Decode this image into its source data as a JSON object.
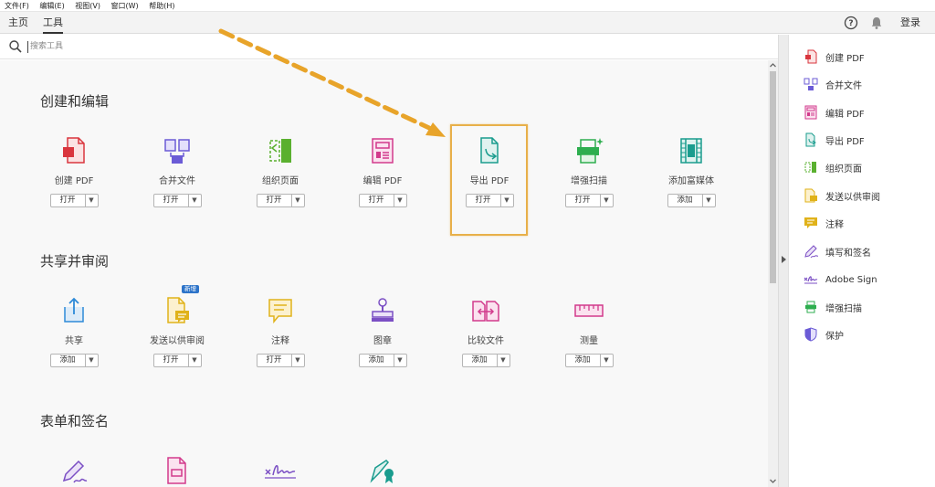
{
  "menubar": {
    "items": [
      "文件(F)",
      "编辑(E)",
      "视图(V)",
      "窗口(W)",
      "帮助(H)"
    ]
  },
  "tabs": {
    "home": "主页",
    "tools": "工具",
    "login": "登录"
  },
  "search": {
    "placeholder": "搜索工具"
  },
  "sections": [
    {
      "title": "创建和编辑",
      "tools": [
        {
          "label": "创建 PDF",
          "button": "打开",
          "icon": "create-pdf-icon",
          "color": "#d9363e"
        },
        {
          "label": "合并文件",
          "button": "打开",
          "icon": "combine-files-icon",
          "color": "#6b5bd6"
        },
        {
          "label": "组织页面",
          "button": "打开",
          "icon": "organize-pages-icon",
          "color": "#5ab02f"
        },
        {
          "label": "编辑 PDF",
          "button": "打开",
          "icon": "edit-pdf-icon",
          "color": "#d23a8c"
        },
        {
          "label": "导出 PDF",
          "button": "打开",
          "icon": "export-pdf-icon",
          "color": "#1a9c8e"
        },
        {
          "label": "增强扫描",
          "button": "打开",
          "icon": "enhance-scan-icon",
          "color": "#2eae4f"
        },
        {
          "label": "添加富媒体",
          "button": "添加",
          "icon": "rich-media-icon",
          "color": "#1a9c8e"
        }
      ]
    },
    {
      "title": "共享并审阅",
      "tools": [
        {
          "label": "共享",
          "button": "添加",
          "icon": "share-icon",
          "color": "#2d8ad8"
        },
        {
          "label": "发送以供审阅",
          "button": "打开",
          "icon": "send-review-icon",
          "color": "#e0b21a",
          "badge": "新增"
        },
        {
          "label": "注释",
          "button": "打开",
          "icon": "comment-icon",
          "color": "#e0b21a"
        },
        {
          "label": "图章",
          "button": "添加",
          "icon": "stamp-icon",
          "color": "#7b4fc4"
        },
        {
          "label": "比较文件",
          "button": "添加",
          "icon": "compare-files-icon",
          "color": "#d23a8c"
        },
        {
          "label": "测量",
          "button": "添加",
          "icon": "measure-icon",
          "color": "#d23a8c"
        }
      ]
    },
    {
      "title": "表单和签名",
      "tools": [
        {
          "label": "",
          "button": "",
          "icon": "fill-sign-icon",
          "color": "#7b4fc4"
        },
        {
          "label": "",
          "button": "",
          "icon": "prepare-form-icon",
          "color": "#d23a8c"
        },
        {
          "label": "",
          "button": "",
          "icon": "adobe-sign-icon",
          "color": "#7b4fc4"
        },
        {
          "label": "",
          "button": "",
          "icon": "certificate-icon",
          "color": "#1a9c8e"
        }
      ]
    }
  ],
  "right_panel": {
    "items": [
      {
        "label": "创建 PDF",
        "icon": "create-pdf-icon",
        "color": "#d9363e"
      },
      {
        "label": "合并文件",
        "icon": "combine-files-icon",
        "color": "#6b5bd6"
      },
      {
        "label": "编辑 PDF",
        "icon": "edit-pdf-icon",
        "color": "#d23a8c"
      },
      {
        "label": "导出 PDF",
        "icon": "export-pdf-icon",
        "color": "#1a9c8e"
      },
      {
        "label": "组织页面",
        "icon": "organize-pages-icon",
        "color": "#5ab02f"
      },
      {
        "label": "发送以供审阅",
        "icon": "send-review-icon",
        "color": "#e0b21a"
      },
      {
        "label": "注释",
        "icon": "comment-icon",
        "color": "#e0b21a"
      },
      {
        "label": "填写和签名",
        "icon": "fill-sign-icon",
        "color": "#7b4fc4"
      },
      {
        "label": "Adobe Sign",
        "icon": "adobe-sign-icon",
        "color": "#7b4fc4"
      },
      {
        "label": "增强扫描",
        "icon": "enhance-scan-icon",
        "color": "#2eae4f"
      },
      {
        "label": "保护",
        "icon": "protect-icon",
        "color": "#6b5bd6"
      }
    ]
  },
  "colors": {
    "highlight": "#e8b04a",
    "arrow": "#e8a42a"
  }
}
